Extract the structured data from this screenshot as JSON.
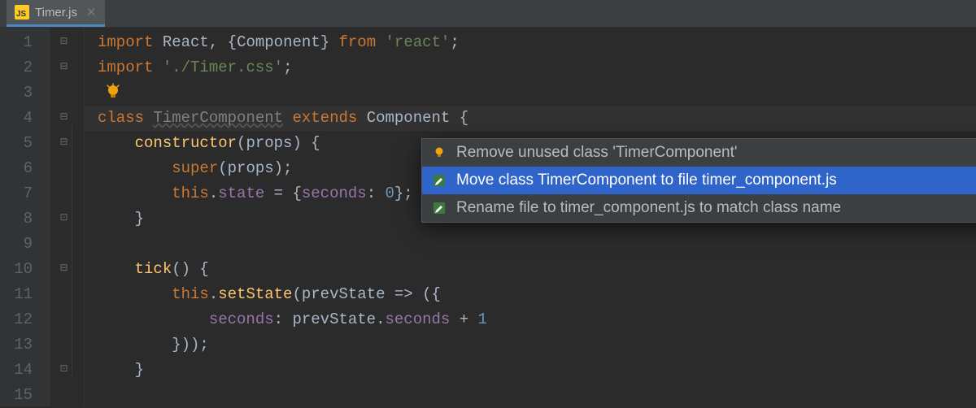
{
  "tab": {
    "filename": "Timer.js",
    "icon": "JS"
  },
  "gutter": {
    "lines": [
      "1",
      "2",
      "3",
      "4",
      "5",
      "6",
      "7",
      "8",
      "9",
      "10",
      "11",
      "12",
      "13",
      "14",
      "15"
    ]
  },
  "code": {
    "l1": {
      "kw1": "import",
      "id1": "React",
      "p1": ", {",
      "id2": "Component",
      "p2": "} ",
      "kw2": "from ",
      "str": "'react'",
      "p3": ";"
    },
    "l2": {
      "kw": "import ",
      "str": "'./Timer.css'",
      "p": ";"
    },
    "l4": {
      "kw1": "class ",
      "cls": "TimerComponent",
      "kw2": " extends ",
      "sup": "Component ",
      "p": "{"
    },
    "l5": {
      "fn": "constructor",
      "p1": "(",
      "arg": "props",
      "p2": ") {"
    },
    "l6": {
      "kw": "super",
      "p1": "(",
      "arg": "props",
      "p2": ");"
    },
    "l7": {
      "kw": "this",
      "p1": ".",
      "prop": "state",
      "p2": " = {",
      "prop2": "seconds",
      "p3": ": ",
      "num": "0",
      "p4": "};"
    },
    "l8": {
      "p": "}"
    },
    "l10": {
      "fn": "tick",
      "p": "() {"
    },
    "l11": {
      "kw": "this",
      "p1": ".",
      "fn": "setState",
      "p2": "(",
      "arg": "prevState",
      "p3": " => ({"
    },
    "l12": {
      "prop": "seconds",
      "p1": ": ",
      "arg": "prevState",
      "p2": ".",
      "prop2": "seconds",
      "p3": " + ",
      "num": "1"
    },
    "l13": {
      "p": "}));"
    },
    "l14": {
      "p": "}"
    }
  },
  "popup": {
    "items": [
      {
        "label": "Remove unused class 'TimerComponent'",
        "icon": "bulb"
      },
      {
        "label": "Move class TimerComponent to file timer_component.js",
        "icon": "pencil"
      },
      {
        "label": "Rename file to timer_component.js to match class name",
        "icon": "pencil"
      }
    ]
  }
}
